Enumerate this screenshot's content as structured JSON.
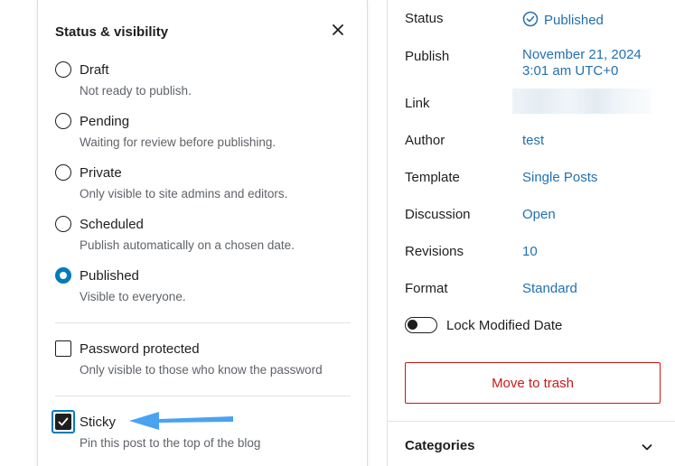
{
  "popover": {
    "title": "Status & visibility",
    "close_icon": "close-icon",
    "options": [
      {
        "label": "Draft",
        "hint": "Not ready to publish.",
        "checked": false
      },
      {
        "label": "Pending",
        "hint": "Waiting for review before publishing.",
        "checked": false
      },
      {
        "label": "Private",
        "hint": "Only visible to site admins and editors.",
        "checked": false
      },
      {
        "label": "Scheduled",
        "hint": "Publish automatically on a chosen date.",
        "checked": false
      },
      {
        "label": "Published",
        "hint": "Visible to everyone.",
        "checked": true
      }
    ],
    "password": {
      "label": "Password protected",
      "hint": "Only visible to those who know the password",
      "checked": false
    },
    "sticky": {
      "label": "Sticky",
      "hint": "Pin this post to the top of the blog",
      "checked": true
    },
    "arrow_color": "#4aa3f0"
  },
  "sidebar": {
    "rows": [
      {
        "label": "Status",
        "value": "Published"
      },
      {
        "label": "Publish",
        "value_line1": "November 21, 2024",
        "value_line2": "3:01 am UTC+0"
      },
      {
        "label": "Link",
        "value": ""
      },
      {
        "label": "Author",
        "value": "test"
      },
      {
        "label": "Template",
        "value": "Single Posts"
      },
      {
        "label": "Discussion",
        "value": "Open"
      },
      {
        "label": "Revisions",
        "value": "10"
      },
      {
        "label": "Format",
        "value": "Standard"
      }
    ],
    "lock_modified_label": "Lock Modified Date",
    "lock_modified_on": false,
    "trash_label": "Move to trash",
    "categories_label": "Categories"
  },
  "colors": {
    "accent": "#007cba",
    "link": "#2271b1",
    "danger": "#cc1818"
  }
}
